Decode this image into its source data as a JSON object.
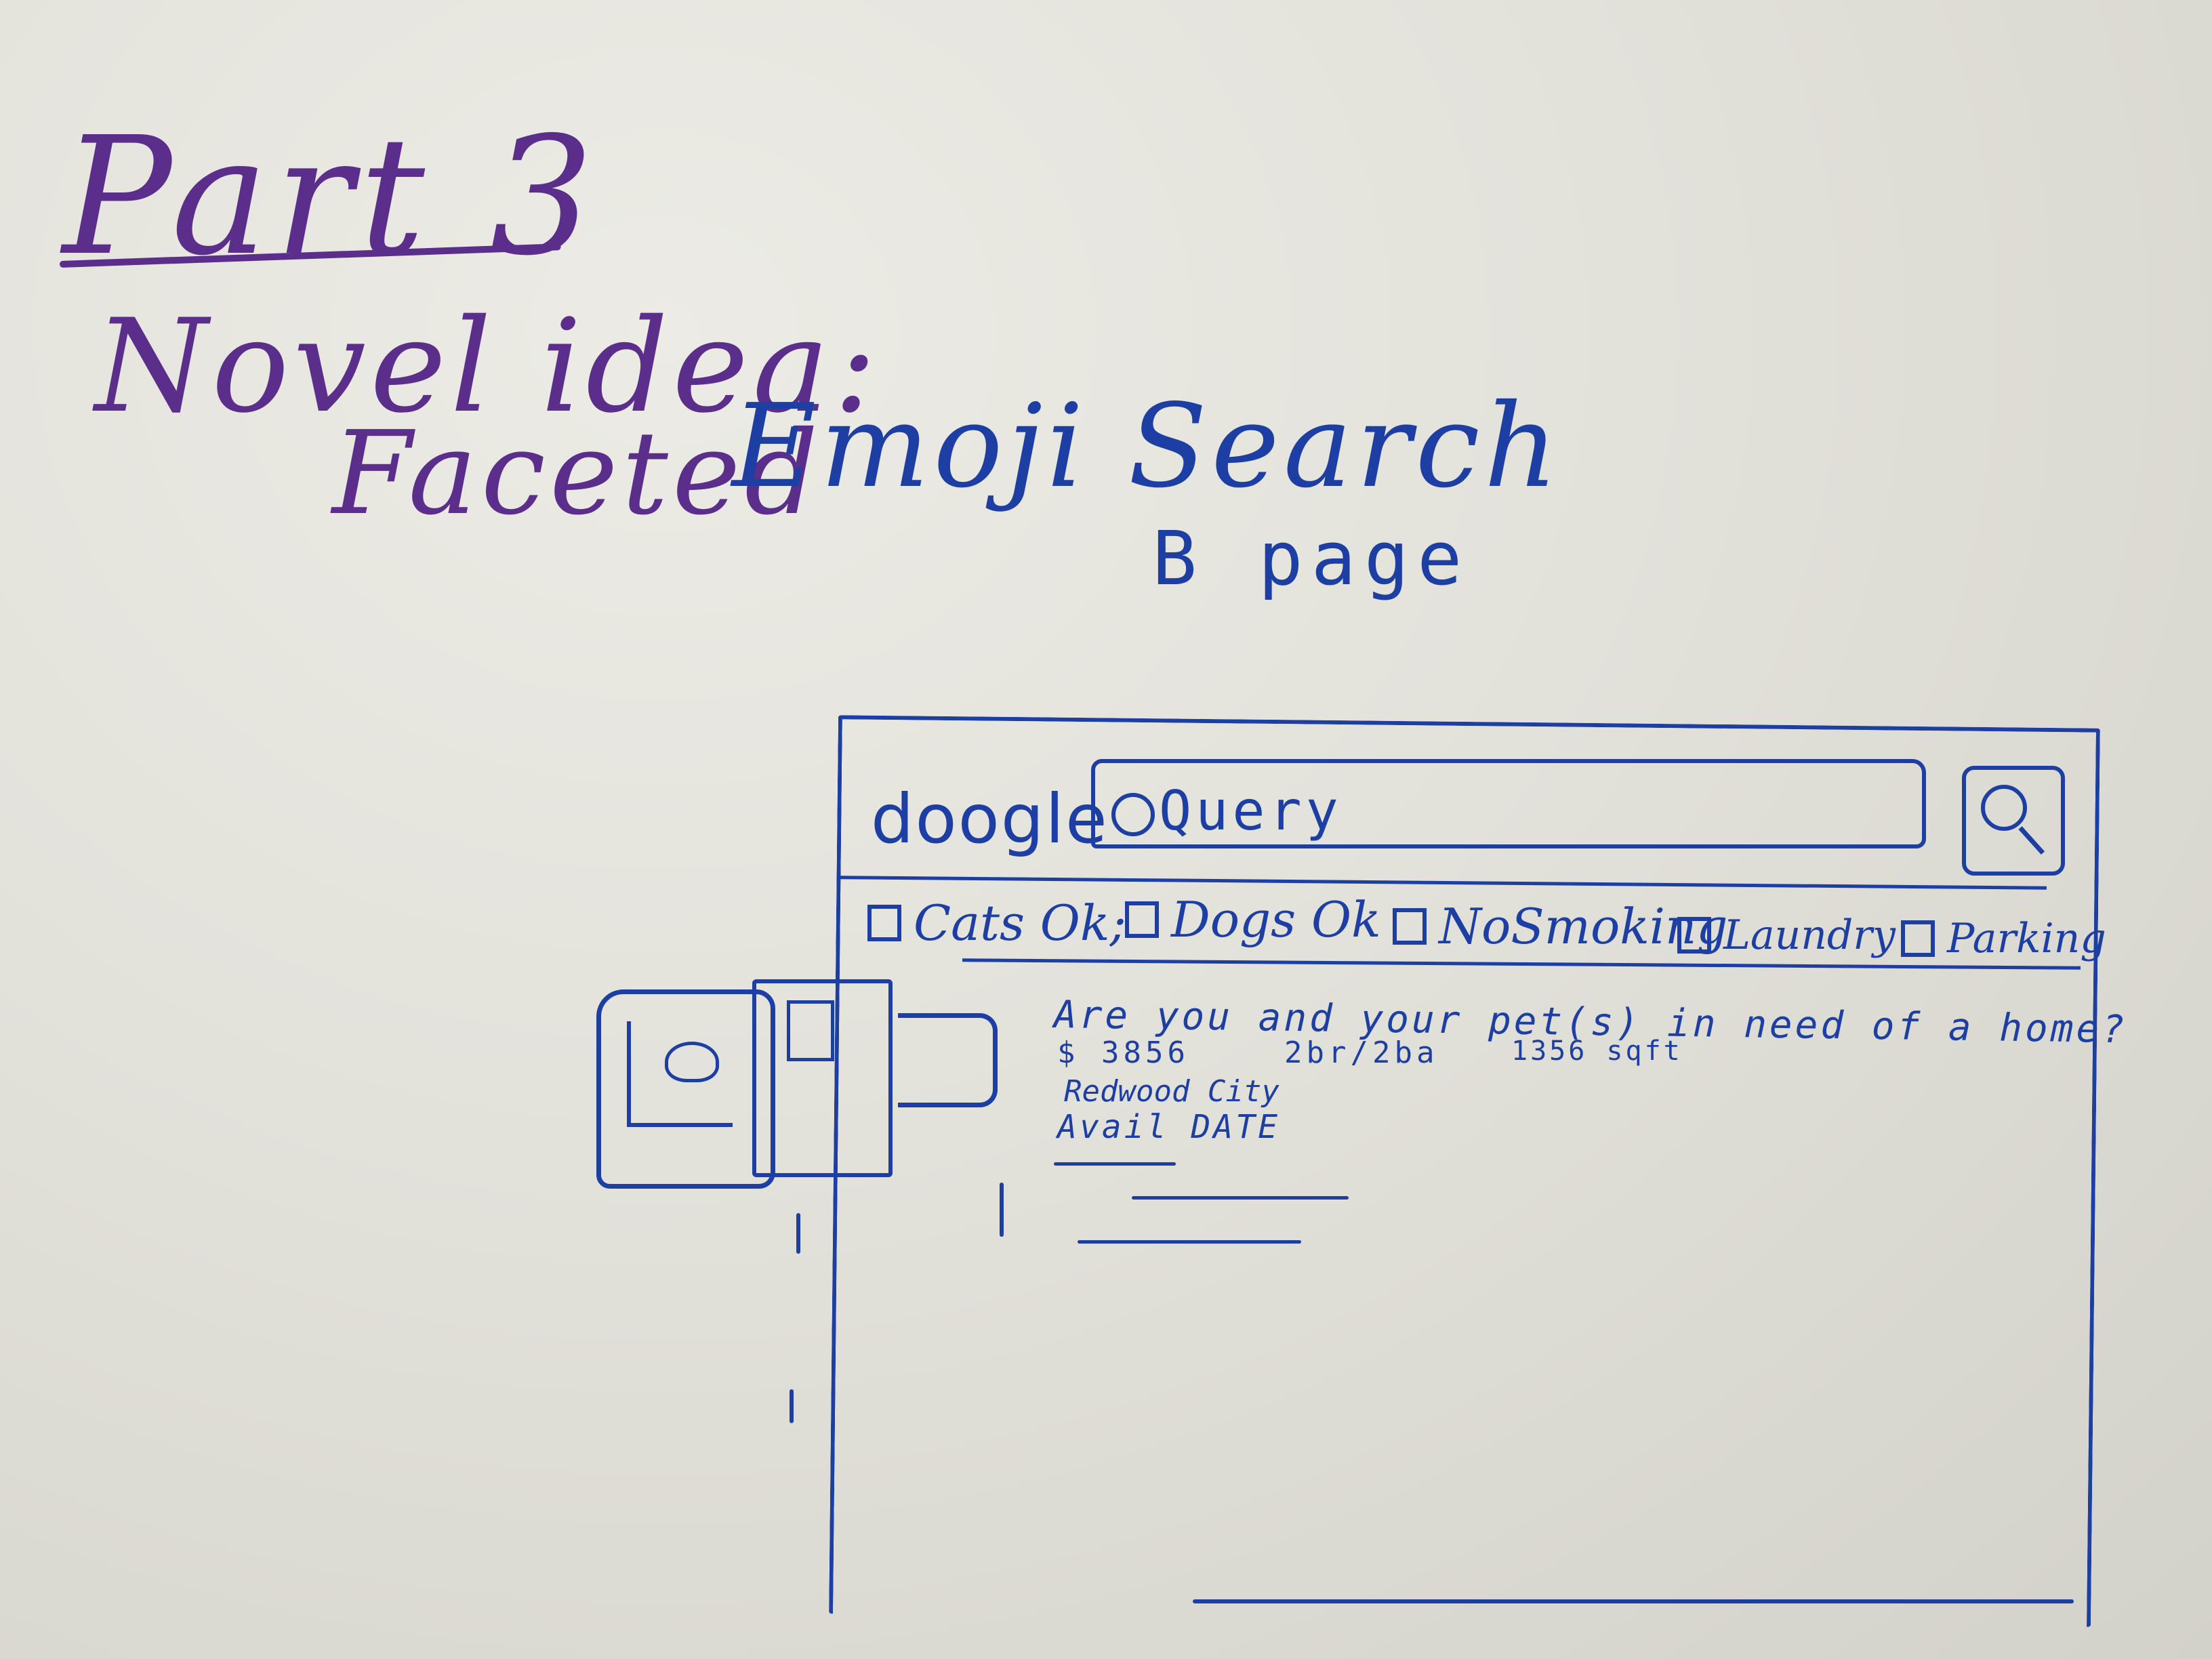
{
  "whiteboard": {
    "title": "Part 3",
    "subtitle": "Novel idea:",
    "idea_faceted": "Faceted",
    "idea_emoji_search": "Emoji Search",
    "page_label": "B page"
  },
  "sketch": {
    "logo": "doogle",
    "search_query": "Query",
    "filters": [
      "Cats Ok;",
      "Dogs Ok",
      "NoSmoking",
      "Laundry",
      "Parking"
    ],
    "listing": {
      "title": "Are you and your pet(s) in need of a home?",
      "price": "$ 3856",
      "beds_baths": "2br/2ba",
      "sqft": "1356 sqft",
      "city": "Redwood City",
      "availability": "Avail DATE"
    }
  },
  "ink_colors": {
    "title": "#5b2e8c",
    "sketch": "#1d3fa3"
  }
}
